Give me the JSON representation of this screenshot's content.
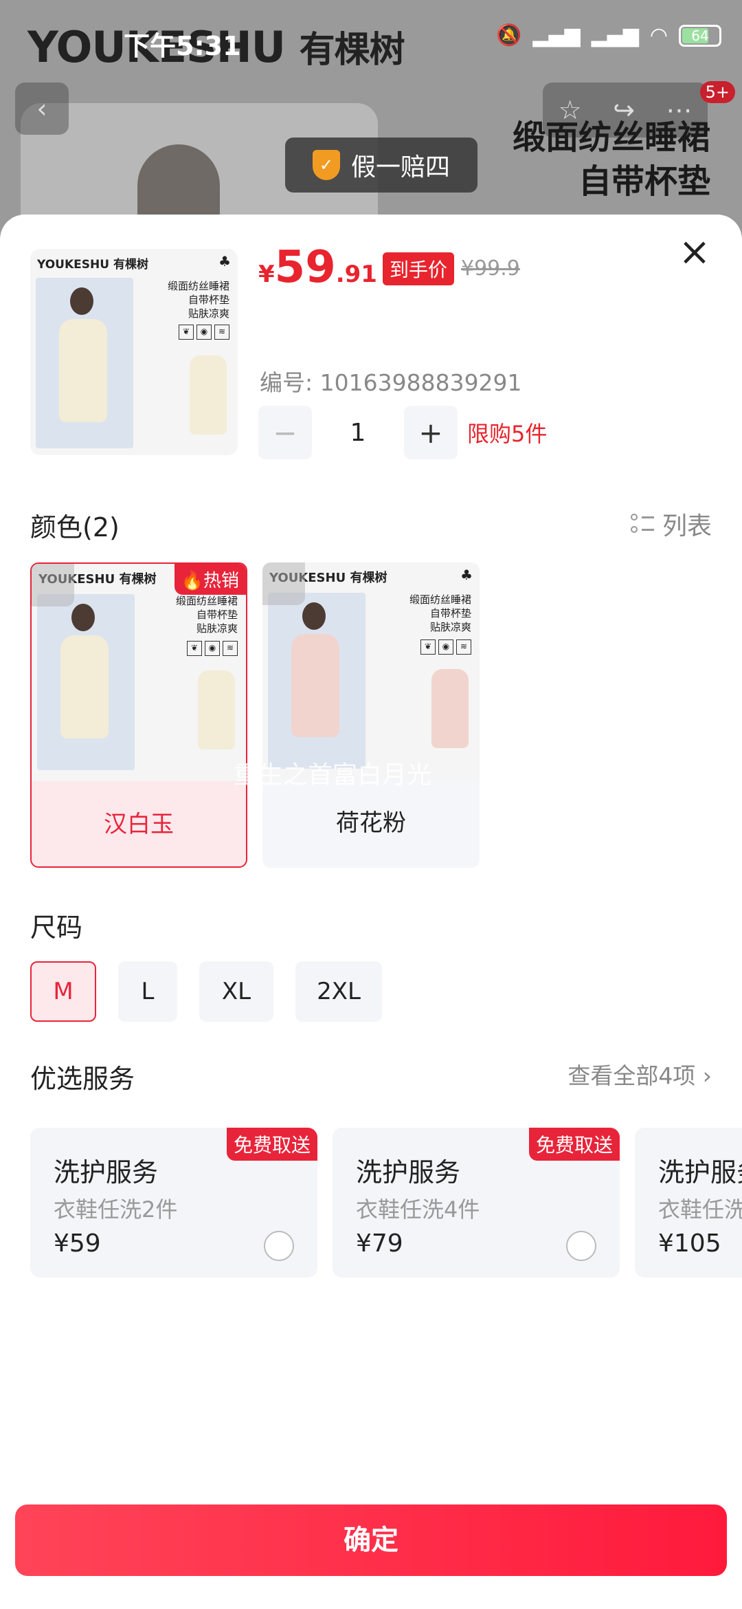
{
  "status_bar": {
    "time": "下午5:31",
    "battery": "64"
  },
  "background": {
    "brand": "YOUKESHU",
    "brand_cn": "有棵树",
    "nav_badge": "5+",
    "guarantee": "假一赔四",
    "product_title": [
      "缎面纺丝睡裙",
      "自带杯垫",
      "贴肤凉爽"
    ]
  },
  "sheet": {
    "price": {
      "symbol": "¥",
      "integer": "59",
      "decimal": ".91",
      "tag": "到手价",
      "original": "¥99.9"
    },
    "sku_number": "编号: 10163988839291",
    "quantity": {
      "minus": "−",
      "value": "1",
      "plus": "+",
      "limit": "限购5件"
    },
    "card": {
      "brand": "YOUKESHU 有棵树",
      "club": "♣",
      "lines": [
        "缎面纺丝睡裙",
        "自带杯垫",
        "贴肤凉爽"
      ]
    },
    "color": {
      "title": "颜色(2)",
      "list_label": "列表",
      "hot_badge": "热销",
      "options": [
        {
          "label": "汉白玉",
          "dress_color": "#f3ecd7",
          "selected": true
        },
        {
          "label": "荷花粉",
          "dress_color": "#f2d4cf",
          "selected": false
        }
      ],
      "watermark": "重生之首富白月光"
    },
    "size": {
      "title": "尺码",
      "options": [
        {
          "label": "M",
          "selected": true
        },
        {
          "label": "L",
          "selected": false
        },
        {
          "label": "XL",
          "selected": false
        },
        {
          "label": "2XL",
          "selected": false
        }
      ]
    },
    "services": {
      "title": "优选服务",
      "view_all": "查看全部4项 ›",
      "items": [
        {
          "name": "洗护服务",
          "desc": "衣鞋任洗2件",
          "price": "¥59",
          "badge": "免费取送"
        },
        {
          "name": "洗护服务",
          "desc": "衣鞋任洗4件",
          "price": "¥79",
          "badge": "免费取送"
        },
        {
          "name": "洗护服务",
          "desc": "衣鞋任洗",
          "price": "¥105",
          "badge": ""
        }
      ]
    },
    "confirm": "确定"
  },
  "colors": {
    "accent": "#e8242e",
    "selected_bg": "#fde8ec"
  }
}
